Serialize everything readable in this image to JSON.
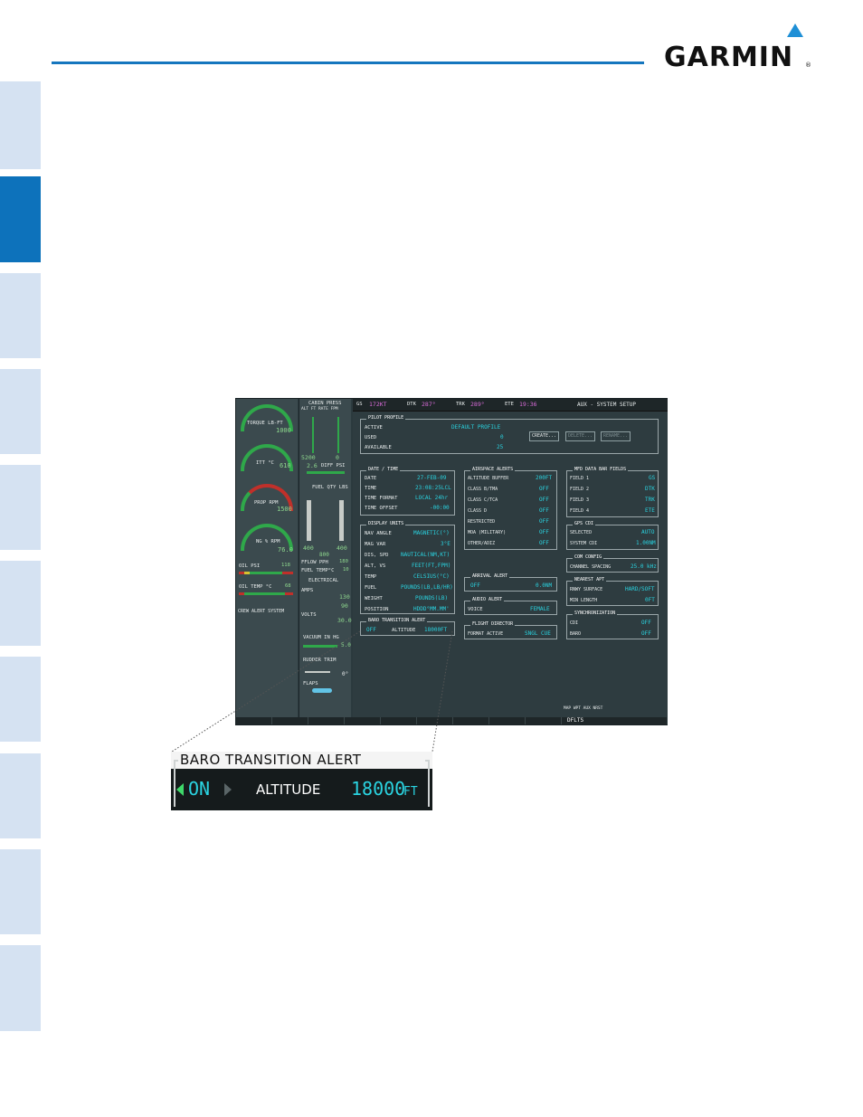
{
  "brand": {
    "name": "GARMIN",
    "registered": "®",
    "accent_color": "#1576be"
  },
  "side_tabs": {
    "active_index": 1,
    "active_color": "#0d72bb",
    "inactive_color": "#d5e2f2"
  },
  "display": {
    "topbar": {
      "gs_label": "GS",
      "gs_value": "172KT",
      "dtk_label": "DTK",
      "dtk_value": "287°",
      "trk_label": "TRK",
      "trk_value": "289°",
      "ete_label": "ETE",
      "ete_value": "19:36",
      "page": "AUX - SYSTEM SETUP"
    },
    "eis": {
      "torque_label": "TORQUE LB-FT",
      "torque_value": "1000",
      "itt_label": "ITT °C",
      "itt_value": "610",
      "prop_label": "PROP RPM",
      "prop_value": "1500",
      "ng_label": "NG % RPM",
      "ng_value": "76.0",
      "oil_psi_label": "OIL PSI",
      "oil_psi_value": "118",
      "oil_temp_label": "OIL TEMP °C",
      "oil_temp_value": "68",
      "cas_label": "CREW ALERT SYSTEM"
    },
    "eis2": {
      "cabin_press": "CABIN PRESS",
      "alt_rate": "ALT FT  RATE FPM",
      "cab_alt": "5200",
      "cab_rate": "0",
      "diff_psi_label": "DIFF PSI",
      "diff_psi_value": "2.6",
      "fuel_qty": "FUEL QTY LBS",
      "fuel_l": "400",
      "fuel_r": "400",
      "fuel_total": "800",
      "fflow_label": "FFLOW PPH",
      "fflow_value": "180",
      "fuel_temp_label": "FUEL TEMP°C",
      "fuel_temp_value": "10",
      "electrical": "ELECTRICAL",
      "amps_label": "AMPS",
      "amps_value": "130",
      "amps_value2": "90",
      "volts_label": "VOLTS",
      "volts_value": "30.0",
      "vacuum_label": "VACUUM IN HG",
      "vacuum_value": "5.0",
      "rudder_label": "RUDDER TRIM",
      "flaps_label": "FLAPS",
      "flaps_value": "0°"
    },
    "pilot_profile": {
      "title": "PILOT PROFILE",
      "active_label": "ACTIVE",
      "active_value": "DEFAULT PROFILE",
      "used_label": "USED",
      "used_value": "0",
      "available_label": "AVAILABLE",
      "available_value": "25",
      "create": "CREATE...",
      "delete": "DELETE...",
      "rename": "RENAME..."
    },
    "date_time": {
      "title": "DATE / TIME",
      "rows": [
        {
          "label": "DATE",
          "value": "27-FEB-09"
        },
        {
          "label": "TIME",
          "value": "23:08:25LCL"
        },
        {
          "label": "TIME FORMAT",
          "value": "LOCAL 24hr"
        },
        {
          "label": "TIME OFFSET",
          "value": "-00:00"
        }
      ]
    },
    "display_units": {
      "title": "DISPLAY UNITS",
      "rows": [
        {
          "label": "NAV ANGLE",
          "value": "MAGNETIC(°)"
        },
        {
          "label": "MAG VAR",
          "value": "3°E"
        },
        {
          "label": "DIS, SPD",
          "value": "NAUTICAL(NM,KT)"
        },
        {
          "label": "ALT, VS",
          "value": "FEET(FT,FPM)"
        },
        {
          "label": "TEMP",
          "value": "CELSIUS(°C)"
        },
        {
          "label": "FUEL",
          "value": "POUNDS(LB,LB/HR)"
        },
        {
          "label": "WEIGHT",
          "value": "POUNDS(LB)"
        },
        {
          "label": "POSITION",
          "value": "HDDD°MM.MM'"
        }
      ]
    },
    "baro_small": {
      "title": "BARO TRANSITION ALERT",
      "state": "OFF",
      "alt_label": "ALTITUDE",
      "alt_value": "18000FT"
    },
    "airspace_alerts": {
      "title": "AIRSPACE ALERTS",
      "rows": [
        {
          "label": "ALTITUDE BUFFER",
          "value": "200FT"
        },
        {
          "label": "CLASS B/TMA",
          "value": "OFF"
        },
        {
          "label": "CLASS C/TCA",
          "value": "OFF"
        },
        {
          "label": "CLASS D",
          "value": "OFF"
        },
        {
          "label": "RESTRICTED",
          "value": "OFF"
        },
        {
          "label": "MOA (MILITARY)",
          "value": "OFF"
        },
        {
          "label": "OTHER/ADIZ",
          "value": "OFF"
        }
      ]
    },
    "arrival_alert": {
      "title": "ARRIVAL ALERT",
      "state": "OFF",
      "value": "0.0NM"
    },
    "audio_alert": {
      "title": "AUDIO ALERT",
      "label": "VOICE",
      "value": "FEMALE"
    },
    "flight_director": {
      "title": "FLIGHT DIRECTOR",
      "label": "FORMAT ACTIVE",
      "value": "SNGL CUE"
    },
    "mfd_fields": {
      "title": "MFD DATA BAR FIELDS",
      "rows": [
        {
          "label": "FIELD 1",
          "value": "GS"
        },
        {
          "label": "FIELD 2",
          "value": "DTK"
        },
        {
          "label": "FIELD 3",
          "value": "TRK"
        },
        {
          "label": "FIELD 4",
          "value": "ETE"
        }
      ]
    },
    "gps_cdi": {
      "title": "GPS CDI",
      "rows": [
        {
          "label": "SELECTED",
          "value": "AUTO"
        },
        {
          "label": "SYSTEM CDI",
          "value": "1.00NM"
        }
      ]
    },
    "com_config": {
      "title": "COM CONFIG",
      "label": "CHANNEL SPACING",
      "value": "25.0 kHz"
    },
    "nearest_apt": {
      "title": "NEAREST APT",
      "rows": [
        {
          "label": "RNWY SURFACE",
          "value": "HARD/SOFT"
        },
        {
          "label": "MIN LENGTH",
          "value": "0FT"
        }
      ]
    },
    "synchronization": {
      "title": "SYNCHRONIZATION",
      "rows": [
        {
          "label": "CDI",
          "value": "OFF"
        },
        {
          "label": "BARO",
          "value": "OFF"
        }
      ]
    },
    "status": "MAP WPT AUX NRST",
    "softkey_active": "DFLTS"
  },
  "zoom": {
    "title": "BARO TRANSITION ALERT",
    "state": "ON",
    "alt_label": "ALTITUDE",
    "alt_value": "18000",
    "alt_unit": "FT"
  }
}
